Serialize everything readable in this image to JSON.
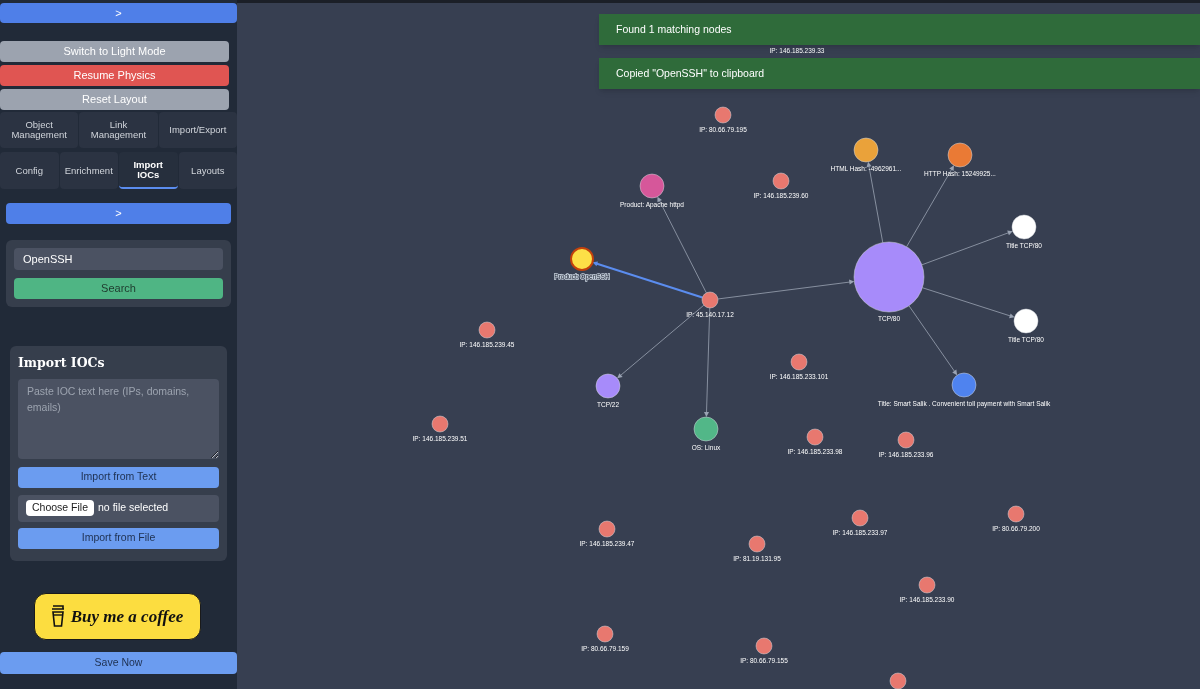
{
  "sidebar": {
    "collapse_button": ">",
    "buttons": [
      {
        "label": "Switch to Light Mode",
        "kind": "neutral"
      },
      {
        "label": "Resume Physics",
        "kind": "danger"
      },
      {
        "label": "Reset Layout",
        "kind": "neutral"
      }
    ],
    "tab_rows": [
      [
        {
          "label": "Object Management",
          "selected": false
        },
        {
          "label": "Link Management",
          "selected": false
        },
        {
          "label": "Import/Export",
          "selected": false
        }
      ],
      [
        {
          "label": "Config",
          "selected": false
        },
        {
          "label": "Enrichment",
          "selected": false
        },
        {
          "label": "Import IOCs",
          "selected": true
        },
        {
          "label": "Layouts",
          "selected": false
        }
      ]
    ],
    "panel_toggle": ">",
    "search": {
      "value": "OpenSSH",
      "button": "Search"
    },
    "import_iocs": {
      "title": "Import IOCs",
      "placeholder": "Paste IOC text here (IPs, domains, emails)",
      "import_text_button": "Import from Text",
      "file_button": "Choose File",
      "file_status": "no file selected",
      "import_file_button": "Import from File"
    },
    "coffee_button": "Buy me a coffee",
    "save_button": "Save Now"
  },
  "toasts": [
    "Found 1 matching nodes",
    "Copied \"OpenSSH\" to clipboard"
  ],
  "graph": {
    "uncovered_labels": [
      "IP: 146.185.239.33"
    ],
    "nodes": [
      {
        "label": "IP: 80.66.79.195",
        "color": "#e8786f",
        "selected": false
      },
      {
        "label": "HTML Hash: -4962961...",
        "color": "#eaa23a",
        "selected": false
      },
      {
        "label": "HTTP Hash: 15249925...",
        "color": "#ea7a35",
        "selected": false
      },
      {
        "label": "IP: 146.185.239.60",
        "color": "#e8786f",
        "selected": false
      },
      {
        "label": "Product: Apache httpd",
        "color": "#d6579a",
        "selected": false
      },
      {
        "label": "Title TCP/80",
        "color": "#ffffff",
        "selected": false
      },
      {
        "label": "Product: OpenSSH",
        "color": "#fde047",
        "selected": true
      },
      {
        "label": "TCP/80",
        "color": "#a78bfa",
        "selected": false
      },
      {
        "label": "IP: 45.140.17.12",
        "color": "#e8786f",
        "selected": false
      },
      {
        "label": "Title TCP/80",
        "color": "#ffffff",
        "selected": false
      },
      {
        "label": "IP: 146.185.239.45",
        "color": "#e8786f",
        "selected": false
      },
      {
        "label": "IP: 146.185.233.101",
        "color": "#e8786f",
        "selected": false
      },
      {
        "label": "TCP/22",
        "color": "#a78bfa",
        "selected": false
      },
      {
        "label": "Title: Smart Salik . Convenient toll payment with Smart Salik",
        "color": "#4f83ef",
        "selected": false
      },
      {
        "label": "IP: 146.185.239.51",
        "color": "#e8786f",
        "selected": false
      },
      {
        "label": "OS: Linux",
        "color": "#52b788",
        "selected": false
      },
      {
        "label": "IP: 146.185.233.98",
        "color": "#e8786f",
        "selected": false
      },
      {
        "label": "IP: 146.185.233.96",
        "color": "#e8786f",
        "selected": false
      },
      {
        "label": "IP: 80.66.79.200",
        "color": "#e8786f",
        "selected": false
      },
      {
        "label": "IP: 146.185.233.97",
        "color": "#e8786f",
        "selected": false
      },
      {
        "label": "IP: 146.185.239.47",
        "color": "#e8786f",
        "selected": false
      },
      {
        "label": "IP: 81.19.131.95",
        "color": "#e8786f",
        "selected": false
      },
      {
        "label": "IP: 146.185.233.90",
        "color": "#e8786f",
        "selected": false
      },
      {
        "label": "IP: 80.66.79.159",
        "color": "#e8786f",
        "selected": false
      },
      {
        "label": "IP: 80.66.79.155",
        "color": "#e8786f",
        "selected": false
      },
      {
        "color": "#e8786f",
        "selected": false
      }
    ]
  }
}
